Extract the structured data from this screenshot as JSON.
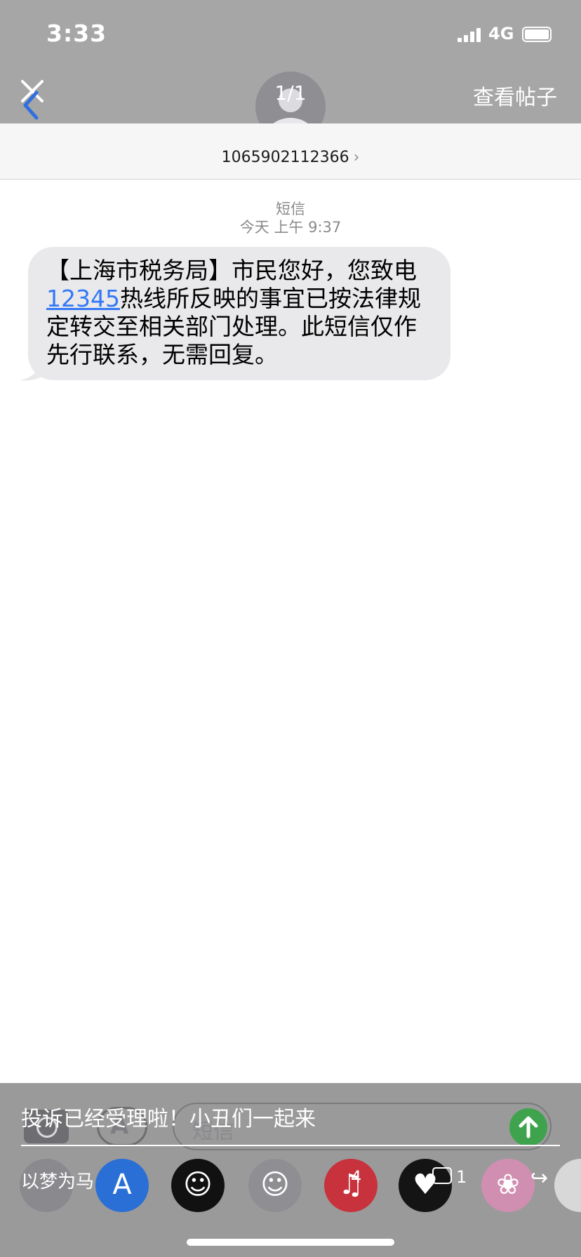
{
  "status_bar": {
    "time": "3:33",
    "network": "4G"
  },
  "nav": {
    "page_counter": "1/1",
    "view_post": "查看帖子"
  },
  "contact": {
    "number": "1065902112366",
    "chevron": "›"
  },
  "message": {
    "type_label": "短信",
    "timestamp": "今天 上午 9:37",
    "text_before": "【上海市税务局】市民您好，您致电",
    "link": "12345",
    "text_after": "热线所反映的事宜已按法律规定转交至相关部门处理。此短信仅作先行联系，无需回复。"
  },
  "composer": {
    "placeholder": "短信"
  },
  "overlay": {
    "caption": "投诉已经受理啦！小丑们一起来",
    "username": "以梦为马",
    "like_count": "4",
    "comment_count": "1"
  },
  "colors": {
    "link": "#3478f6",
    "send": "#3fa34d",
    "bubble": "#e9e9eb"
  }
}
